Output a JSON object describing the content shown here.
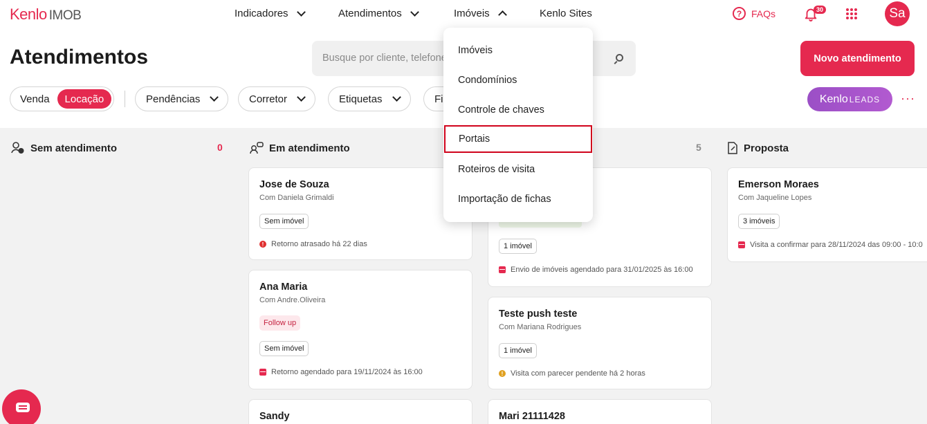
{
  "app": {
    "brand": "Kenlo",
    "product": "IMOB"
  },
  "nav": {
    "indicadores": "Indicadores",
    "atendimentos": "Atendimentos",
    "imoveis": "Imóveis",
    "sites": "Kenlo Sites",
    "faq": "FAQs",
    "notifications_count": "30",
    "avatar_initials": "Sa"
  },
  "header": {
    "title": "Atendimentos",
    "search_placeholder": "Busque por cliente, telefone",
    "new_button": "Novo atendimento"
  },
  "filters": {
    "segment": [
      "Venda",
      "Locação"
    ],
    "active_segment": "Locação",
    "pendencias": "Pendências",
    "corretor": "Corretor",
    "etiquetas": "Etiquetas",
    "filtros_partial": "Fil",
    "leads_brand": "Kenlo",
    "leads_label": "LEADS",
    "more": "···"
  },
  "columns": [
    {
      "title": "Sem atendimento",
      "count": "0",
      "count_color": "#e5294f"
    },
    {
      "title": "Em atendimento",
      "count": ""
    },
    {
      "title": "",
      "count": "5",
      "count_color": "#8a8a8a"
    },
    {
      "title": "Proposta",
      "count": ""
    }
  ],
  "cards": {
    "c1": {
      "name": "Jose de Souza",
      "with": "Com Daniela Grimaldi",
      "tag": "Sem imóvel",
      "footer": "Retorno atrasado há 22 dias"
    },
    "c2": {
      "name": "Ana Maria",
      "with": "Com Andre.Oliveira",
      "tag_follow": "Follow up",
      "tag": "Sem imóvel",
      "footer": "Retorno agendado para 19/11/2024 às 16:00"
    },
    "c3": {
      "name": "Sandy"
    },
    "c4": {
      "tag": "1 imóvel",
      "footer": "Envio de imóveis agendado para 31/01/2025 às 16:00"
    },
    "c5": {
      "name": "Teste push teste",
      "with": "Com Mariana Rodrigues",
      "tag": "1 imóvel",
      "footer": "Visita com parecer pendente há 2 horas"
    },
    "c6": {
      "name": "Mari 21111428"
    },
    "c7": {
      "name": "Emerson Moraes",
      "with": "Com Jaqueline Lopes",
      "tag": "3 imóveis",
      "footer": "Visita a confirmar para 28/11/2024 das 09:00 - 10:0"
    }
  },
  "dropdown": {
    "items": [
      "Imóveis",
      "Condomínios",
      "Controle de chaves",
      "Portais",
      "Roteiros de visita",
      "Importação de fichas"
    ],
    "highlighted": "Portais"
  },
  "colors": {
    "accent": "#e5294f",
    "leads": "#a855c8",
    "warn": "#e0a020",
    "error": "#e03030"
  }
}
